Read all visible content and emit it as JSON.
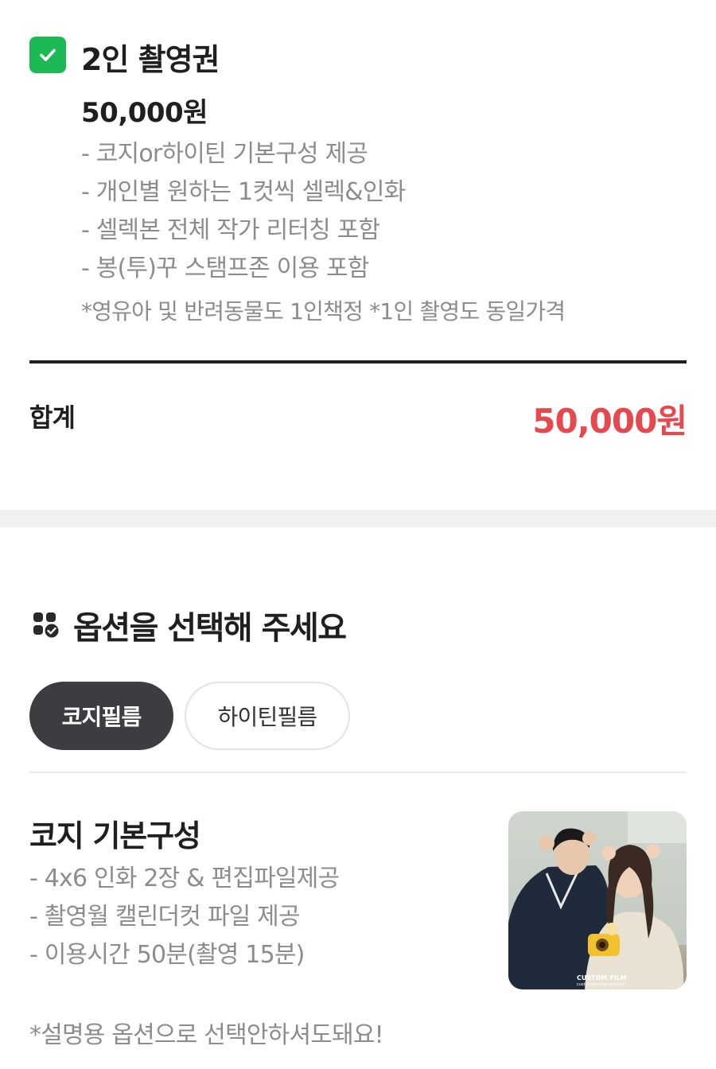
{
  "product": {
    "checked": true,
    "title": "2인 촬영권",
    "price": "50,000원",
    "features": [
      "- 코지or하이틴 기본구성 제공",
      "- 개인별 원하는 1컷씩 셀렉&인화",
      "- 셀렉본 전체 작가 리터칭 포함",
      "- 봉(투)꾸 스탬프존 이용 포함"
    ],
    "note": "*영유아 및 반려동물도 1인책정 *1인 촬영도 동일가격"
  },
  "total": {
    "label": "합계",
    "value": "50,000원"
  },
  "options": {
    "heading": "옵션을 선택해 주세요",
    "tabs": [
      {
        "label": "코지필름",
        "active": true
      },
      {
        "label": "하이틴필름",
        "active": false
      }
    ],
    "item": {
      "title": "코지 기본구성",
      "features": [
        "- 4x6 인화 2장 & 편집파일제공",
        "- 촬영월 캘린더컷 파일 제공",
        "- 이용시간 50분(촬영 15분)"
      ],
      "thumbnail_caption": "CUSTOM FILM",
      "thumbnail_subcaption": "customize your moment"
    },
    "note": "*설명용 옵션으로 선택안하셔도돼요!"
  },
  "colors": {
    "check_green": "#1db954",
    "total_red": "#e5484d",
    "active_pill": "#3c3c41",
    "muted_text": "#8c8c8c"
  }
}
